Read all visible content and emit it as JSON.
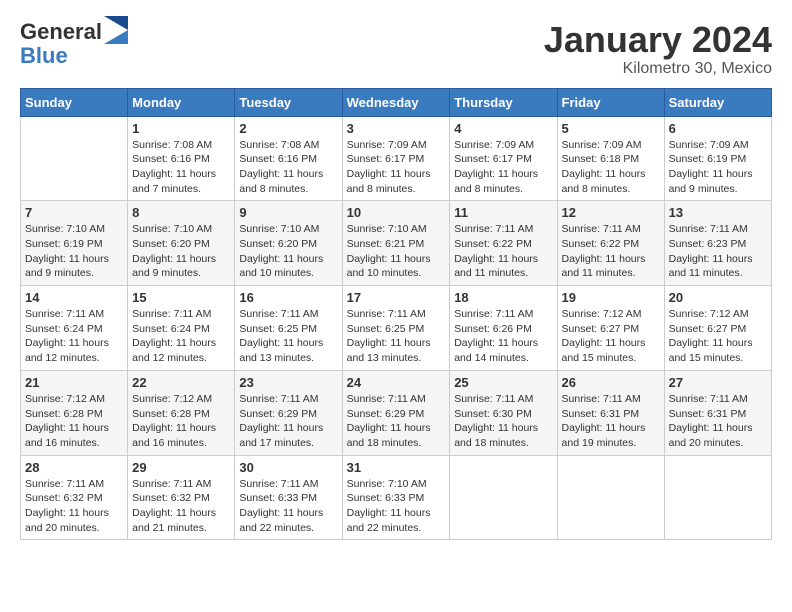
{
  "logo": {
    "general": "General",
    "blue": "Blue"
  },
  "title": "January 2024",
  "subtitle": "Kilometro 30, Mexico",
  "days_header": [
    "Sunday",
    "Monday",
    "Tuesday",
    "Wednesday",
    "Thursday",
    "Friday",
    "Saturday"
  ],
  "weeks": [
    [
      {
        "day": "",
        "info": ""
      },
      {
        "day": "1",
        "info": "Sunrise: 7:08 AM\nSunset: 6:16 PM\nDaylight: 11 hours\nand 7 minutes."
      },
      {
        "day": "2",
        "info": "Sunrise: 7:08 AM\nSunset: 6:16 PM\nDaylight: 11 hours\nand 8 minutes."
      },
      {
        "day": "3",
        "info": "Sunrise: 7:09 AM\nSunset: 6:17 PM\nDaylight: 11 hours\nand 8 minutes."
      },
      {
        "day": "4",
        "info": "Sunrise: 7:09 AM\nSunset: 6:17 PM\nDaylight: 11 hours\nand 8 minutes."
      },
      {
        "day": "5",
        "info": "Sunrise: 7:09 AM\nSunset: 6:18 PM\nDaylight: 11 hours\nand 8 minutes."
      },
      {
        "day": "6",
        "info": "Sunrise: 7:09 AM\nSunset: 6:19 PM\nDaylight: 11 hours\nand 9 minutes."
      }
    ],
    [
      {
        "day": "7",
        "info": "Sunrise: 7:10 AM\nSunset: 6:19 PM\nDaylight: 11 hours\nand 9 minutes."
      },
      {
        "day": "8",
        "info": "Sunrise: 7:10 AM\nSunset: 6:20 PM\nDaylight: 11 hours\nand 9 minutes."
      },
      {
        "day": "9",
        "info": "Sunrise: 7:10 AM\nSunset: 6:20 PM\nDaylight: 11 hours\nand 10 minutes."
      },
      {
        "day": "10",
        "info": "Sunrise: 7:10 AM\nSunset: 6:21 PM\nDaylight: 11 hours\nand 10 minutes."
      },
      {
        "day": "11",
        "info": "Sunrise: 7:11 AM\nSunset: 6:22 PM\nDaylight: 11 hours\nand 11 minutes."
      },
      {
        "day": "12",
        "info": "Sunrise: 7:11 AM\nSunset: 6:22 PM\nDaylight: 11 hours\nand 11 minutes."
      },
      {
        "day": "13",
        "info": "Sunrise: 7:11 AM\nSunset: 6:23 PM\nDaylight: 11 hours\nand 11 minutes."
      }
    ],
    [
      {
        "day": "14",
        "info": "Sunrise: 7:11 AM\nSunset: 6:24 PM\nDaylight: 11 hours\nand 12 minutes."
      },
      {
        "day": "15",
        "info": "Sunrise: 7:11 AM\nSunset: 6:24 PM\nDaylight: 11 hours\nand 12 minutes."
      },
      {
        "day": "16",
        "info": "Sunrise: 7:11 AM\nSunset: 6:25 PM\nDaylight: 11 hours\nand 13 minutes."
      },
      {
        "day": "17",
        "info": "Sunrise: 7:11 AM\nSunset: 6:25 PM\nDaylight: 11 hours\nand 13 minutes."
      },
      {
        "day": "18",
        "info": "Sunrise: 7:11 AM\nSunset: 6:26 PM\nDaylight: 11 hours\nand 14 minutes."
      },
      {
        "day": "19",
        "info": "Sunrise: 7:12 AM\nSunset: 6:27 PM\nDaylight: 11 hours\nand 15 minutes."
      },
      {
        "day": "20",
        "info": "Sunrise: 7:12 AM\nSunset: 6:27 PM\nDaylight: 11 hours\nand 15 minutes."
      }
    ],
    [
      {
        "day": "21",
        "info": "Sunrise: 7:12 AM\nSunset: 6:28 PM\nDaylight: 11 hours\nand 16 minutes."
      },
      {
        "day": "22",
        "info": "Sunrise: 7:12 AM\nSunset: 6:28 PM\nDaylight: 11 hours\nand 16 minutes."
      },
      {
        "day": "23",
        "info": "Sunrise: 7:11 AM\nSunset: 6:29 PM\nDaylight: 11 hours\nand 17 minutes."
      },
      {
        "day": "24",
        "info": "Sunrise: 7:11 AM\nSunset: 6:29 PM\nDaylight: 11 hours\nand 18 minutes."
      },
      {
        "day": "25",
        "info": "Sunrise: 7:11 AM\nSunset: 6:30 PM\nDaylight: 11 hours\nand 18 minutes."
      },
      {
        "day": "26",
        "info": "Sunrise: 7:11 AM\nSunset: 6:31 PM\nDaylight: 11 hours\nand 19 minutes."
      },
      {
        "day": "27",
        "info": "Sunrise: 7:11 AM\nSunset: 6:31 PM\nDaylight: 11 hours\nand 20 minutes."
      }
    ],
    [
      {
        "day": "28",
        "info": "Sunrise: 7:11 AM\nSunset: 6:32 PM\nDaylight: 11 hours\nand 20 minutes."
      },
      {
        "day": "29",
        "info": "Sunrise: 7:11 AM\nSunset: 6:32 PM\nDaylight: 11 hours\nand 21 minutes."
      },
      {
        "day": "30",
        "info": "Sunrise: 7:11 AM\nSunset: 6:33 PM\nDaylight: 11 hours\nand 22 minutes."
      },
      {
        "day": "31",
        "info": "Sunrise: 7:10 AM\nSunset: 6:33 PM\nDaylight: 11 hours\nand 22 minutes."
      },
      {
        "day": "",
        "info": ""
      },
      {
        "day": "",
        "info": ""
      },
      {
        "day": "",
        "info": ""
      }
    ]
  ]
}
